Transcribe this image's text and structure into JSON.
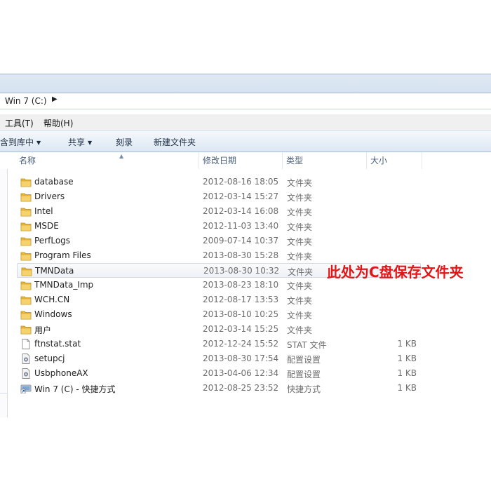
{
  "address": {
    "path": "Win 7 (C:)"
  },
  "menu": {
    "tools": "工具(T)",
    "help": "帮助(H)"
  },
  "toolbar": {
    "include_in_library": "包含到库中",
    "share": "共享",
    "burn": "刻录",
    "new_folder": "新建文件夹"
  },
  "columns": {
    "name": "名称",
    "modified": "修改日期",
    "type": "类型",
    "size": "大小"
  },
  "files": [
    {
      "name": "database",
      "modified": "2012-08-16 18:05",
      "type": "文件夹",
      "size": "",
      "icon": "folder-icon"
    },
    {
      "name": "Drivers",
      "modified": "2012-03-14 15:27",
      "type": "文件夹",
      "size": "",
      "icon": "folder-icon"
    },
    {
      "name": "Intel",
      "modified": "2012-03-14 16:08",
      "type": "文件夹",
      "size": "",
      "icon": "folder-icon"
    },
    {
      "name": "MSDE",
      "modified": "2012-11-03 13:40",
      "type": "文件夹",
      "size": "",
      "icon": "folder-icon"
    },
    {
      "name": "PerfLogs",
      "modified": "2009-07-14 10:37",
      "type": "文件夹",
      "size": "",
      "icon": "folder-icon"
    },
    {
      "name": "Program Files",
      "modified": "2013-08-30 15:28",
      "type": "文件夹",
      "size": "",
      "icon": "folder-icon"
    },
    {
      "name": "TMNData",
      "modified": "2013-08-30 10:32",
      "type": "文件夹",
      "size": "",
      "icon": "folder-icon"
    },
    {
      "name": "TMNData_Imp",
      "modified": "2013-08-23 18:10",
      "type": "文件夹",
      "size": "",
      "icon": "folder-icon"
    },
    {
      "name": "WCH.CN",
      "modified": "2012-08-17 13:53",
      "type": "文件夹",
      "size": "",
      "icon": "folder-icon"
    },
    {
      "name": "Windows",
      "modified": "2013-08-10 10:25",
      "type": "文件夹",
      "size": "",
      "icon": "folder-icon"
    },
    {
      "name": "用户",
      "modified": "2012-03-14 15:25",
      "type": "文件夹",
      "size": "",
      "icon": "folder-icon"
    },
    {
      "name": "ftnstat.stat",
      "modified": "2012-12-24 15:52",
      "type": "STAT 文件",
      "size": "1 KB",
      "icon": "document-icon"
    },
    {
      "name": "setupcj",
      "modified": "2013-08-30 17:54",
      "type": "配置设置",
      "size": "1 KB",
      "icon": "config-icon"
    },
    {
      "name": "UsbphoneAX",
      "modified": "2013-04-06 12:34",
      "type": "配置设置",
      "size": "1 KB",
      "icon": "config-icon"
    },
    {
      "name": "Win 7 (C) - 快捷方式",
      "modified": "2012-08-25 23:52",
      "type": "快捷方式",
      "size": "1 KB",
      "icon": "shortcut-icon"
    }
  ],
  "annotation": "此处为C盘保存文件夹",
  "colors": {
    "annotation": "#e21616",
    "folder": "#e8b83a",
    "header_text": "#4c607a"
  }
}
